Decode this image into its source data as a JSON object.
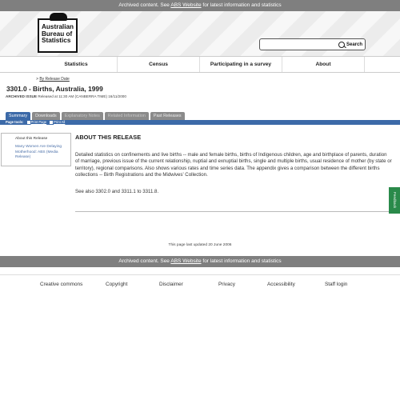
{
  "banner": {
    "prefix": "Archived content. See",
    "link": "ABS Website",
    "suffix": "for latest information and statistics"
  },
  "logo": {
    "line1": "Australian",
    "line2": "Bureau of",
    "line3": "Statistics"
  },
  "search": {
    "placeholder": "",
    "button_label": "Search",
    "icon": "search-icon"
  },
  "nav": {
    "items": [
      "Statistics",
      "Census",
      "Participating in a survey",
      "About"
    ]
  },
  "breadcrumb": {
    "marker": ">",
    "link": "By Release Date"
  },
  "page": {
    "title": "3301.0 - Births, Australia, 1999",
    "archived_label": "ARCHIVED ISSUE",
    "archived_text": "Released at 11:30 AM (CANBERRA TIME) 16/11/2000"
  },
  "tabs": [
    "Summary",
    "Downloads",
    "Explanatory Notes",
    "Related Information",
    "Past Releases"
  ],
  "toolbar": {
    "label": "Page tools:",
    "print_page": "Print Page",
    "print_all": "Print All"
  },
  "sidebar": {
    "heading": "About this Release",
    "link": "Many Women Are Delaying Motherhood: ABS (Media Release)"
  },
  "content": {
    "heading": "ABOUT THIS RELEASE",
    "paragraph1": "Detailed statistics on confinements and live births -- male and female births, births of Indigenous children, age and birthplace of parents, duration of marriage, previous issue of the current relationship, nuptial and exnuptial births, single and multiple births, usual residence of mother (by state or territory), regional comparisons. Also shows various rates and time series data. The appendix gives a comparison between the different births collections -- Birth Registrations and the Midwives' Collection.",
    "paragraph2": "See also 3302.0 and 3311.1 to 3311.8."
  },
  "feedback": {
    "label": "Feedback"
  },
  "updated": "This page last updated 20 June 2006",
  "footer": {
    "links": [
      "Creative commons",
      "Copyright",
      "Disclaimer",
      "Privacy",
      "Accessibility",
      "Staff login"
    ]
  },
  "colors": {
    "banner": "#7f7f7f",
    "tab_active": "#3c6aa8",
    "feedback": "#2a8a4a",
    "link": "#4a6fa8"
  }
}
